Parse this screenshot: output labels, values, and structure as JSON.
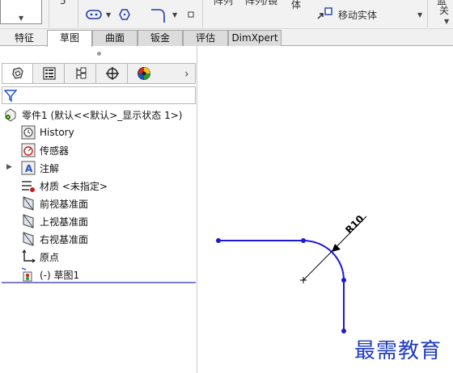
{
  "ribbon": {
    "partial_items": [
      "体",
      "移动实体"
    ],
    "clipped_labels": [
      "阵列",
      "阵列/镜",
      "蓝",
      "关"
    ]
  },
  "tabs": [
    {
      "label": "特征",
      "active": false
    },
    {
      "label": "草图",
      "active": true
    },
    {
      "label": "曲面",
      "active": false
    },
    {
      "label": "钣金",
      "active": false
    },
    {
      "label": "评估",
      "active": false
    },
    {
      "label": "DimXpert",
      "active": false
    }
  ],
  "panel": {
    "manager_tabs": [
      "featuremanager-icon",
      "propertymanager-icon",
      "configurationmanager-icon",
      "dimxpertmanager-icon",
      "displaymanager-icon"
    ],
    "more_glyph": "›",
    "tree": {
      "root": "零件1 (默认<<默认>_显示状态 1>)",
      "items": [
        {
          "label": "History",
          "icon": "history-icon"
        },
        {
          "label": "传感器",
          "icon": "sensor-icon"
        },
        {
          "label": "注解",
          "icon": "annotation-icon"
        },
        {
          "label": "材质 <未指定>",
          "icon": "material-icon"
        },
        {
          "label": "前视基准面",
          "icon": "plane-icon"
        },
        {
          "label": "上视基准面",
          "icon": "plane-icon"
        },
        {
          "label": "右视基准面",
          "icon": "plane-icon"
        },
        {
          "label": "原点",
          "icon": "origin-icon"
        },
        {
          "label": "(-) 草图1",
          "icon": "sketch-icon"
        }
      ]
    }
  },
  "sketch": {
    "dimension_label": "R10",
    "colors": {
      "sketch": "#1a1ad6",
      "dimension": "#000000",
      "watermark": "#1d3bbf"
    }
  },
  "watermark": "最需教育"
}
